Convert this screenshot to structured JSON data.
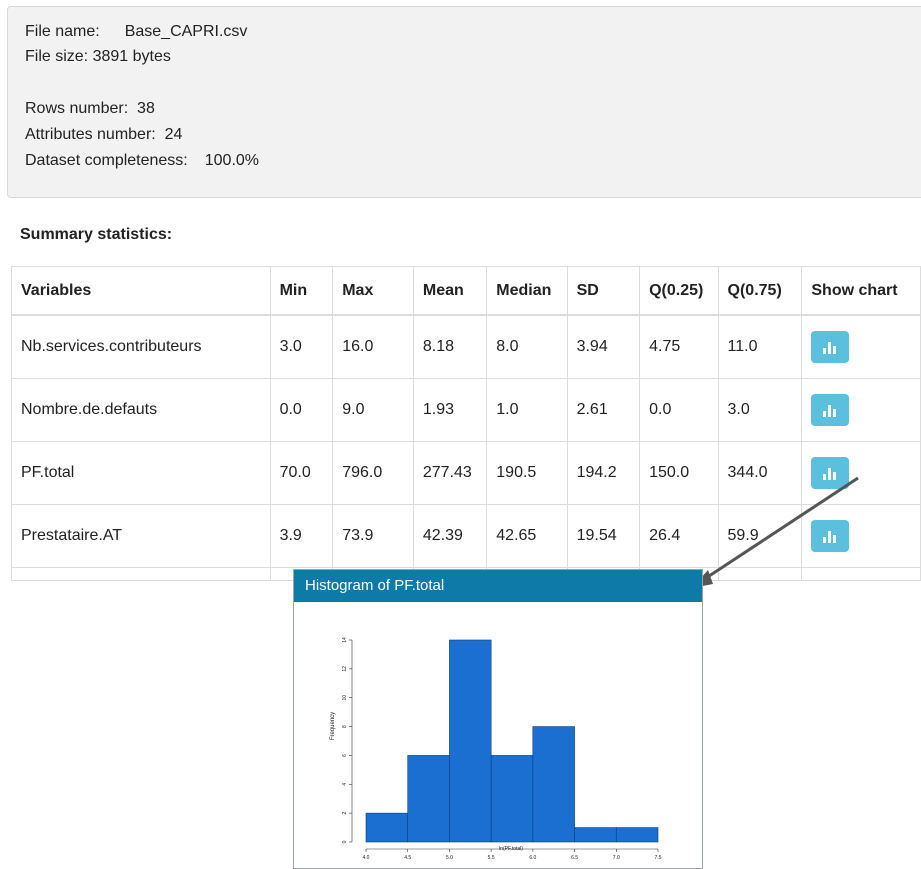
{
  "file_info": {
    "file_name_label": "File name:",
    "file_name": "Base_CAPRI.csv",
    "file_size_label": "File size:",
    "file_size": "3891 bytes",
    "rows_label": "Rows number:",
    "rows": "38",
    "attributes_label": "Attributes number:",
    "attributes": "24",
    "completeness_label": "Dataset completeness:",
    "completeness": "100.0%"
  },
  "summary_title": "Summary statistics:",
  "table": {
    "headers": [
      "Variables",
      "Min",
      "Max",
      "Mean",
      "Median",
      "SD",
      "Q(0.25)",
      "Q(0.75)",
      "Show chart"
    ],
    "rows": [
      [
        "Nb.services.contributeurs",
        "3.0",
        "16.0",
        "8.18",
        "8.0",
        "3.94",
        "4.75",
        "11.0"
      ],
      [
        "Nombre.de.defauts",
        "0.0",
        "9.0",
        "1.93",
        "1.0",
        "2.61",
        "0.0",
        "3.0"
      ],
      [
        "PF.total",
        "70.0",
        "796.0",
        "277.43",
        "190.5",
        "194.2",
        "150.0",
        "344.0"
      ],
      [
        "Prestataire.AT",
        "3.9",
        "73.9",
        "42.39",
        "42.65",
        "19.54",
        "26.4",
        "59.9"
      ]
    ]
  },
  "histogram": {
    "title": "Histogram of PF.total",
    "xlabel": "ln(PF.total)",
    "ylabel": "Frequency",
    "chart_color": "#1a6fd0",
    "chart_data": {
      "type": "bar",
      "bins": [
        [
          4.0,
          4.5
        ],
        [
          4.5,
          5.0
        ],
        [
          5.0,
          5.5
        ],
        [
          5.5,
          6.0
        ],
        [
          6.0,
          6.5
        ],
        [
          6.5,
          7.0
        ],
        [
          7.0,
          7.5
        ]
      ],
      "values": [
        2,
        6,
        14,
        6,
        8,
        1,
        1
      ],
      "xlim": [
        4.0,
        7.5
      ],
      "ylim": [
        0,
        14
      ],
      "x_ticks": [
        "4.0",
        "4.5",
        "5.0",
        "5.5",
        "6.0",
        "6.5",
        "7.0",
        "7.5"
      ],
      "y_ticks": [
        "0",
        "2",
        "4",
        "6",
        "8",
        "10",
        "12",
        "14"
      ]
    }
  },
  "colors": {
    "button": "#5bc0de",
    "panel_header": "#0d7aa8",
    "info_bg": "#f2f2f2"
  },
  "icons": {
    "chart_button": "bar-chart-icon"
  }
}
